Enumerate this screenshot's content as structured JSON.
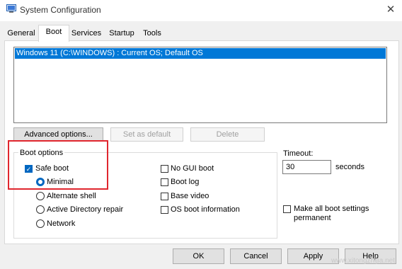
{
  "window": {
    "title": "System Configuration"
  },
  "tabs": [
    "General",
    "Boot",
    "Services",
    "Startup",
    "Tools"
  ],
  "os_list": [
    "Windows 11 (C:\\WINDOWS) : Current OS; Default OS"
  ],
  "buttons": {
    "advanced": "Advanced options...",
    "set_default": "Set as default",
    "delete": "Delete"
  },
  "boot_options": {
    "group_label": "Boot options",
    "safe_boot": "Safe boot",
    "minimal": "Minimal",
    "alternate_shell": "Alternate shell",
    "ad_repair": "Active Directory repair",
    "network": "Network",
    "no_gui": "No GUI boot",
    "boot_log": "Boot log",
    "base_video": "Base video",
    "os_info": "OS boot information"
  },
  "timeout": {
    "label": "Timeout:",
    "value": "30",
    "unit": "seconds"
  },
  "make_permanent": {
    "line1": "Make all boot settings",
    "line2": "permanent"
  },
  "footer": {
    "ok": "OK",
    "cancel": "Cancel",
    "apply": "Apply",
    "help": "Help"
  },
  "watermark": "www.xitongzhijia.net",
  "colors": {
    "selection": "#0078d7",
    "highlight_box": "#e0262e",
    "check_accent": "#0067c0"
  }
}
